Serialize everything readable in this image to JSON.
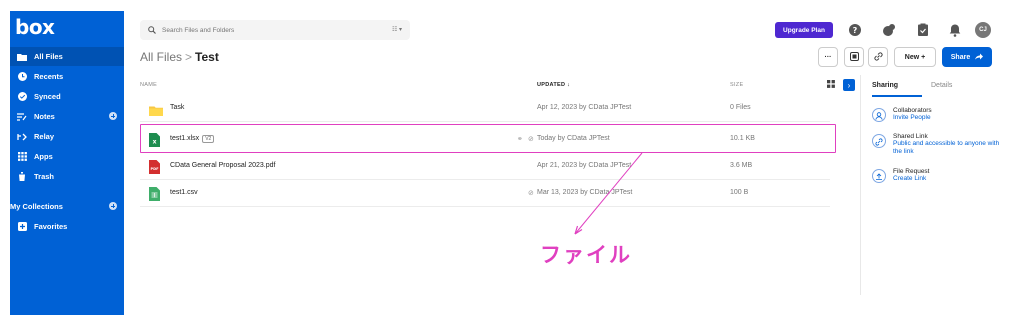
{
  "brand": {
    "logo": "box",
    "accent": "#0061d5"
  },
  "sidebar": {
    "items": [
      {
        "label": "All Files",
        "icon": "folder-icon",
        "active": true
      },
      {
        "label": "Recents",
        "icon": "clock-icon"
      },
      {
        "label": "Synced",
        "icon": "check-circle-icon"
      },
      {
        "label": "Notes",
        "icon": "notes-icon"
      },
      {
        "label": "Relay",
        "icon": "relay-icon"
      },
      {
        "label": "Apps",
        "icon": "grid-icon"
      },
      {
        "label": "Trash",
        "icon": "trash-icon"
      }
    ],
    "collections_label": "My Collections",
    "favorites_label": "Favorites"
  },
  "search": {
    "placeholder": "Search Files and Folders"
  },
  "header": {
    "upgrade_label": "Upgrade Plan",
    "avatar_initials": "CJ"
  },
  "breadcrumb": {
    "root": "All Files",
    "separator": ">",
    "current": "Test"
  },
  "toolbar": {
    "more_label": "···",
    "new_label": "New +",
    "share_label": "Share"
  },
  "table": {
    "headers": {
      "name": "NAME",
      "updated": "UPDATED ↓",
      "size": "SIZE"
    },
    "rows": [
      {
        "name": "Task",
        "type": "folder",
        "updated": "Apr 12, 2023 by CData JPTest",
        "size": "0 Files"
      },
      {
        "name": "test1.xlsx",
        "version": "V2",
        "type": "xlsx",
        "updated": "Today by CData JPTest",
        "size": "10.1 KB"
      },
      {
        "name": "CData General Proposal 2023.pdf",
        "type": "pdf",
        "updated": "Apr 21, 2023 by CData JPTest",
        "size": "3.6 MB"
      },
      {
        "name": "test1.csv",
        "type": "csv",
        "updated": "Mar 13, 2023 by CData JPTest",
        "size": "100 B"
      }
    ]
  },
  "panel": {
    "tabs": [
      "Sharing",
      "Details"
    ],
    "items": [
      {
        "title": "Collaborators",
        "link": "Invite People",
        "icon": "person-icon"
      },
      {
        "title": "Shared Link",
        "link": "Public and accessible to anyone with the link",
        "icon": "link-icon"
      },
      {
        "title": "File Request",
        "link": "Create Link",
        "icon": "upload-icon"
      }
    ]
  },
  "annotation": {
    "text": "ファイル",
    "color": "#e040c0"
  }
}
